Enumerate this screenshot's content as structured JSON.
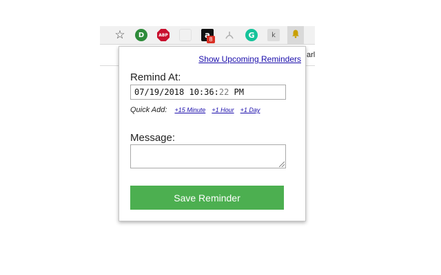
{
  "toolbar": {
    "icons": [
      {
        "name": "star-icon",
        "glyph": "☆"
      },
      {
        "name": "green-circle-extension-icon",
        "glyph": "D"
      },
      {
        "name": "adblock-plus-icon",
        "glyph": "ABP"
      },
      {
        "name": "ghost-extension-icon",
        "glyph": ""
      },
      {
        "name": "amazon-icon",
        "glyph": "a"
      },
      {
        "name": "pdf-icon",
        "glyph": "⚡"
      },
      {
        "name": "grammarly-icon",
        "glyph": "G"
      },
      {
        "name": "kiwi-extension-icon",
        "glyph": "k"
      },
      {
        "name": "bell-icon",
        "glyph": "🔔"
      }
    ],
    "amazon_badge": "8",
    "bookmark_partial": "arl"
  },
  "popup": {
    "upcoming_link": "Show Upcoming Reminders",
    "remind_label": "Remind At:",
    "datetime": {
      "date": "07/19/2018",
      "time": "10:36:",
      "seconds": "22",
      "ampm": "PM"
    },
    "quick_add_label": "Quick Add:",
    "quick_links": [
      "+15 Minute",
      "+1 Hour",
      "+1 Day"
    ],
    "message_label": "Message:",
    "message_value": "",
    "save_button": "Save Reminder"
  },
  "colors": {
    "save_button_bg": "#4caf50",
    "link": "#1a0dab"
  }
}
